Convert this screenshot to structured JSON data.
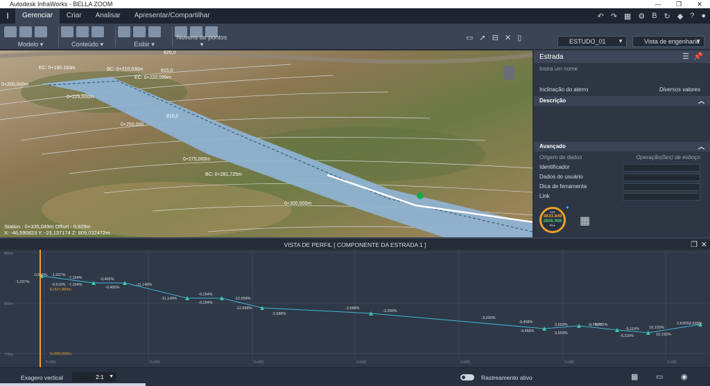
{
  "window": {
    "title": "Autodesk InfraWorks - BELLA ZOOM",
    "controls": [
      "—",
      "❐",
      "✕"
    ]
  },
  "tabs": [
    "Gerenciar",
    "Criar",
    "Analisar",
    "Apresentar/Compartilhar"
  ],
  "ribbon": {
    "groups": [
      {
        "label": "Modelo ▾"
      },
      {
        "label": "Conteúdo ▾"
      },
      {
        "label": "Exibir ▾"
      },
      {
        "label": "Nuvens de pontos ▾"
      }
    ],
    "proposal": "ESTUDO_01",
    "view_mode": "Vista de engenharia"
  },
  "viewport": {
    "station_readout": "Station : 0+335,049m  Offset : 0,929m",
    "xyz_readout": "X: -46,590823  Y: -23,137174  Z: 809,032472m",
    "labels": {
      "ec190": "EC: 0+190,183m",
      "bc210": "BC: 0+210,636m",
      "ec220": "EC: 0+220,099m",
      "st200": "0+200,000m",
      "st225": "0+225,000m",
      "st250": "0+250,000",
      "st275": "0+275,000m",
      "bc281": "BC: 0+281,725m",
      "st300": "0+300,000m",
      "c810": "810,0",
      "c815": "815,0",
      "c820": "820,0"
    }
  },
  "panel": {
    "title": "Estrada",
    "name_placeholder": "Insira um nome",
    "fill_slope_label": "Inclinação do aterro",
    "fill_slope_value": "Diversos valores",
    "desc_section": "Descrição",
    "adv_section": "Avançado",
    "origin_label": "Origem de dados",
    "origin_value": "Operação(ões) de esboço",
    "id_label": "Identificador",
    "user_data_label": "Dados do usuário",
    "tooltip_label": "Dica de ferramenta",
    "link_label": "Link",
    "gauge": {
      "top_label": "CUT",
      "cut": "3833.849",
      "fill": "2806.966",
      "bottom_label": "FILL"
    }
  },
  "profile": {
    "title": "VISTA DE PERFIL [ COMPONENTE DA ESTRADA 1 ]",
    "current_station": "0+000,000m",
    "el_label": "El 827,889m",
    "yticks": [
      "825m",
      "800m",
      "775m"
    ],
    "xticks": [
      "0+000",
      "0+200",
      "0+400",
      "0+600",
      "0+800",
      "1+000",
      "1+200"
    ],
    "slopes": [
      "-1,037%",
      "-0,510%",
      "-1,037%",
      "-0,510%",
      "-7,154%",
      "-7,154%",
      "-0,405%",
      "-0,405%",
      "-11,149%",
      "-11,149%",
      "-0,154%",
      "-0,154%",
      "-12,698%",
      "-12,698%",
      "-2,688%",
      "-2,688%",
      "-3,200%",
      "-3,200%",
      "-9,458%",
      "-9,458%",
      "3,659%",
      "3,659%",
      "-8,775%",
      "-8,775%",
      "-5,116%",
      "-5,116%",
      "10,193%",
      "10,193%",
      "2,635%",
      "2,635%"
    ]
  },
  "statusbar": {
    "vert_exag_label": "Exagero vertical",
    "vert_exag_value": "2:1",
    "tracking_label": "Rastreamento ativo"
  },
  "colors": {
    "accent": "#e8a32a",
    "profile_line": "#3fb6d8",
    "pvi_marker": "#39c9a2",
    "road": "#8fb4d6"
  }
}
